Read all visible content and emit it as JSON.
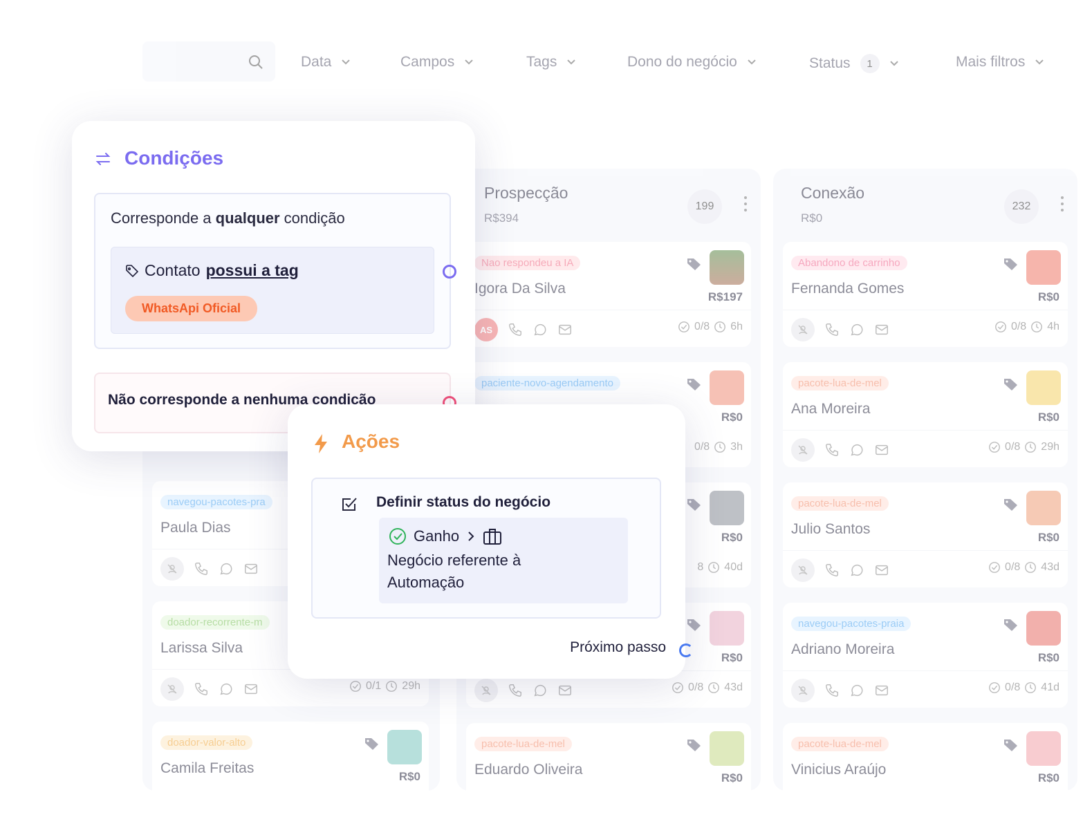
{
  "filters": {
    "search_placeholder": "",
    "items": [
      {
        "label": "Data"
      },
      {
        "label": "Campos"
      },
      {
        "label": "Tags"
      },
      {
        "label": "Dono do negócio"
      },
      {
        "label": "Status",
        "count": "1"
      },
      {
        "label": "Mais filtros"
      }
    ]
  },
  "columns": [
    {
      "title": "Prospecção",
      "sum": "R$394",
      "count": "199"
    },
    {
      "title": "Conexão",
      "sum": "R$0",
      "count": "232"
    }
  ],
  "cards": {
    "left": [
      {
        "tag": "navegou-pacotes-pra",
        "name": "Paula Dias",
        "value": "",
        "meta_tasks": "",
        "meta_time": ""
      },
      {
        "tag": "doador-recorrente-m",
        "name": "Larissa Silva",
        "value": "",
        "meta_tasks": "0/1",
        "meta_time": "29h"
      },
      {
        "tag": "doador-valor-alto",
        "name": "Camila Freitas",
        "value": "R$0",
        "meta_tasks": "",
        "meta_time": ""
      }
    ],
    "prospeccao": [
      {
        "tag": "Nao respondeu a IA",
        "name": "Igora Da Silva",
        "value": "R$197",
        "owner": "AS",
        "meta_tasks": "0/8",
        "meta_time": "6h"
      },
      {
        "tag": "paciente-novo-agendamento",
        "name": "",
        "value": "R$0",
        "meta_tasks": "0/8",
        "meta_time": "3h"
      },
      {
        "tag": "",
        "name": "",
        "value": "R$0",
        "meta_tasks": "8",
        "meta_time": "40d"
      },
      {
        "tag": "",
        "name": "",
        "value": "R$0",
        "meta_tasks": "0/8",
        "meta_time": "43d"
      },
      {
        "tag": "pacote-lua-de-mel",
        "name": "Eduardo Oliveira",
        "value": "R$0",
        "meta_tasks": "",
        "meta_time": ""
      }
    ],
    "conexao": [
      {
        "tag": "Abandono de carrinho",
        "name": "Fernanda Gomes",
        "value": "R$0",
        "meta_tasks": "0/8",
        "meta_time": "4h"
      },
      {
        "tag": "pacote-lua-de-mel",
        "name": "Ana Moreira",
        "value": "R$0",
        "meta_tasks": "0/8",
        "meta_time": "29h"
      },
      {
        "tag": "pacote-lua-de-mel",
        "name": "Julio Santos",
        "value": "R$0",
        "meta_tasks": "0/8",
        "meta_time": "43d"
      },
      {
        "tag": "navegou-pacotes-praia",
        "name": "Adriano Moreira",
        "value": "R$0",
        "meta_tasks": "0/8",
        "meta_time": "41d"
      },
      {
        "tag": "pacote-lua-de-mel",
        "name": "Vinicius Araújo",
        "value": "R$0",
        "meta_tasks": "",
        "meta_time": ""
      }
    ]
  },
  "conditions": {
    "title": "Condições",
    "match_prefix": "Corresponde a ",
    "match_strong": "qualquer",
    "match_suffix": " condição",
    "rule_prefix": "Contato ",
    "rule_link": "possui a tag",
    "rule_tag": "WhatsApi Oficial",
    "no_match": "Não corresponde a nenhuma condição"
  },
  "actions": {
    "title": "Ações",
    "heading": "Definir status do negócio",
    "status": "Ganho",
    "detail": "Negócio referente à Automação",
    "next_step": "Próximo passo"
  },
  "colors": {
    "conditions_accent": "#7b6cf0",
    "actions_accent": "#f29a4a",
    "tag_orange_bg": "#fdc9b4",
    "tag_orange_text": "#f15a24",
    "success_green": "#2fb35a"
  }
}
